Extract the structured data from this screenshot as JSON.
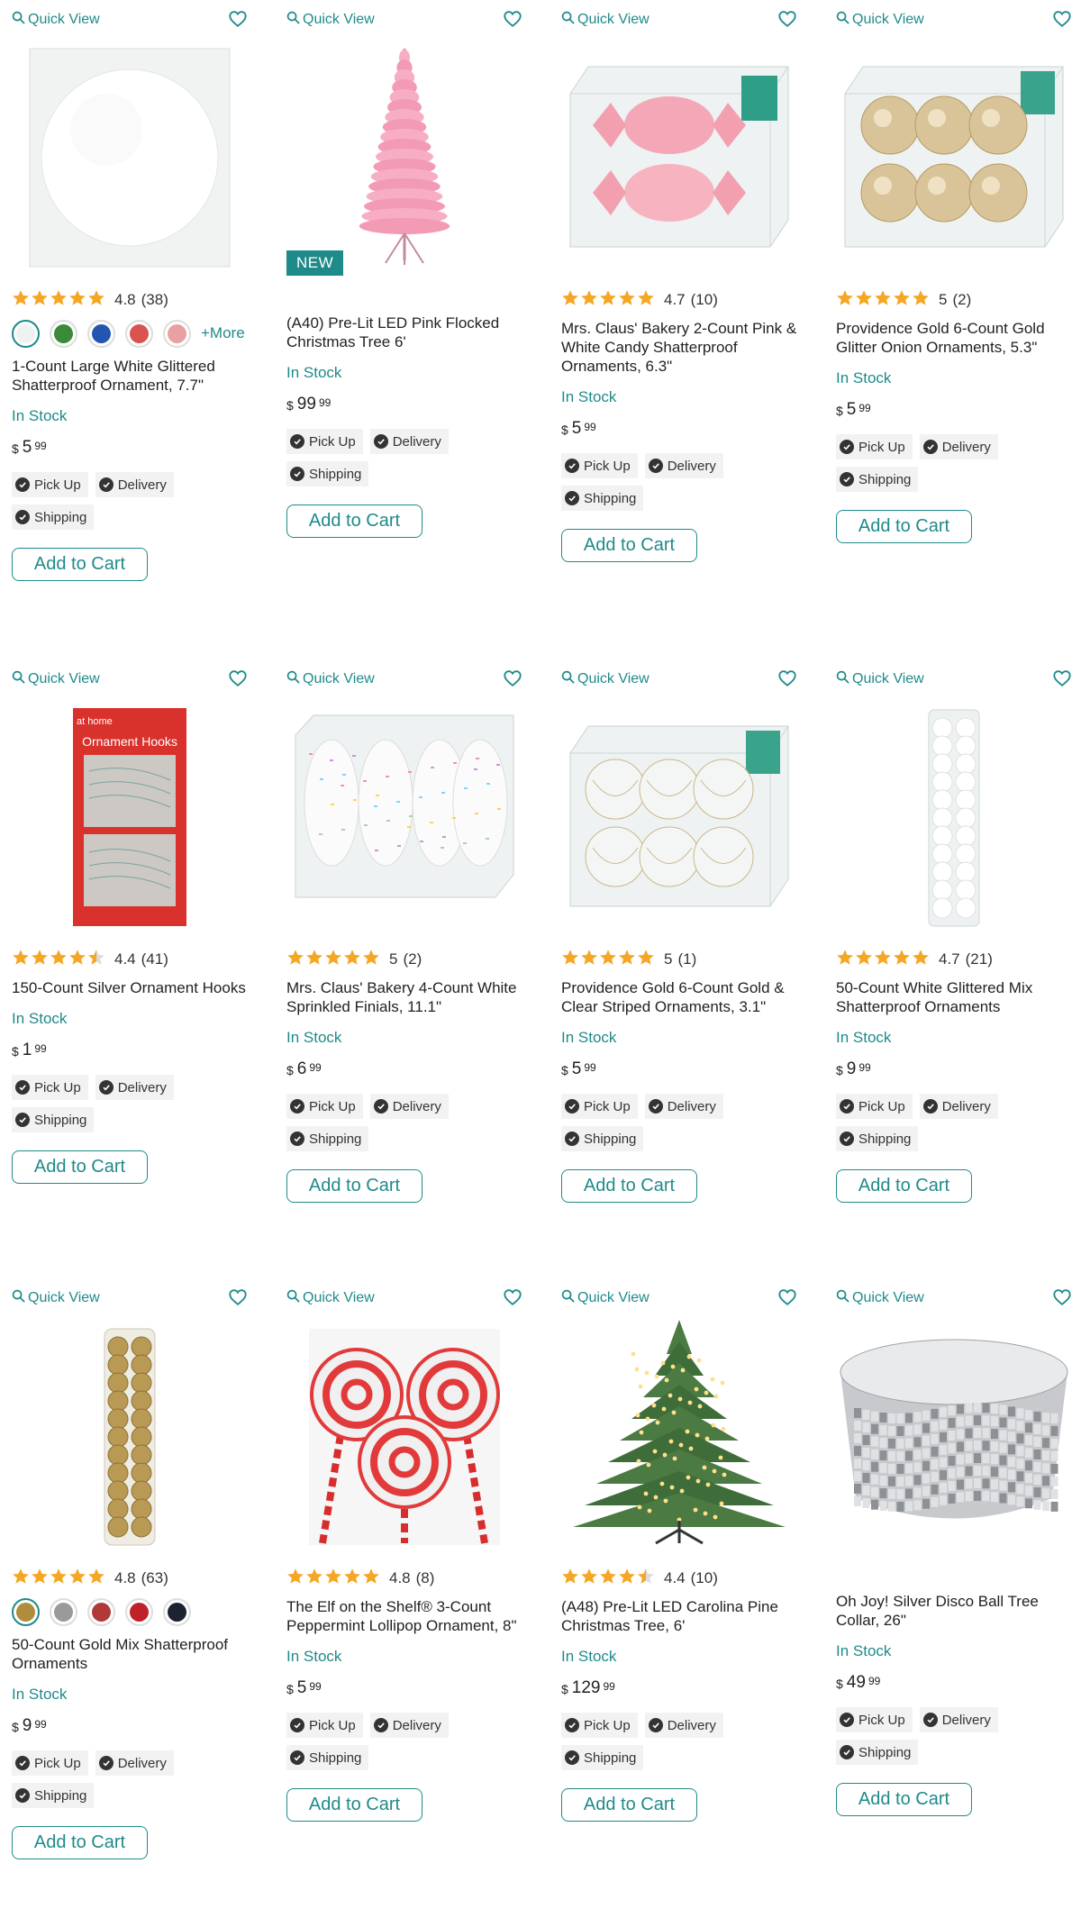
{
  "labels": {
    "quick_view": "Quick View",
    "add_to_cart": "Add to Cart",
    "pick_up": "Pick Up",
    "delivery": "Delivery",
    "shipping": "Shipping",
    "new_badge": "NEW",
    "more": "+More",
    "currency": "$"
  },
  "colors": {
    "accent": "#1f8a8a",
    "star": "#f5a623"
  },
  "products": [
    {
      "title": "1-Count Large White Glittered Shatterproof Ornament, 7.7\"",
      "rating": "4.8",
      "count": "(38)",
      "stars": 5,
      "stock": "In Stock",
      "dollars": "5",
      "cents": "99",
      "image": "white-ball",
      "badge": "",
      "swatches": [
        "#eef2f2",
        "#3a8a3a",
        "#2456b0",
        "#d9534f",
        "#e9a0a0"
      ]
    },
    {
      "title": "(A40) Pre-Lit LED Pink Flocked Christmas Tree 6'",
      "rating": "",
      "count": "",
      "stars": 0,
      "stock": "In Stock",
      "dollars": "99",
      "cents": "99",
      "image": "pink-tree",
      "badge": "NEW",
      "swatches": []
    },
    {
      "title": "Mrs. Claus' Bakery 2-Count Pink & White Candy Shatterproof Ornaments, 6.3\"",
      "rating": "4.7",
      "count": "(10)",
      "stars": 5,
      "stock": "In Stock",
      "dollars": "5",
      "cents": "99",
      "image": "pink-candy",
      "badge": "",
      "swatches": []
    },
    {
      "title": "Providence Gold 6-Count Gold Glitter Onion Ornaments, 5.3\"",
      "rating": "5",
      "count": "(2)",
      "stars": 5,
      "stock": "In Stock",
      "dollars": "5",
      "cents": "99",
      "image": "gold-onion",
      "badge": "",
      "swatches": []
    },
    {
      "title": "150-Count Silver Ornament Hooks",
      "rating": "4.4",
      "count": "(41)",
      "stars": 4.5,
      "stock": "In Stock",
      "dollars": "1",
      "cents": "99",
      "image": "hooks",
      "badge": "",
      "swatches": [],
      "pkg_brand": "at home",
      "pkg_title": "Ornament Hooks"
    },
    {
      "title": "Mrs. Claus' Bakery 4-Count White Sprinkled Finials, 11.1\"",
      "rating": "5",
      "count": "(2)",
      "stars": 5,
      "stock": "In Stock",
      "dollars": "6",
      "cents": "99",
      "image": "finials",
      "badge": "",
      "swatches": []
    },
    {
      "title": "Providence Gold 6-Count Gold & Clear Striped Ornaments, 3.1\"",
      "rating": "5",
      "count": "(1)",
      "stars": 5,
      "stock": "In Stock",
      "dollars": "5",
      "cents": "99",
      "image": "clear-striped",
      "badge": "",
      "swatches": []
    },
    {
      "title": "50-Count White Glittered Mix Shatterproof Ornaments",
      "rating": "4.7",
      "count": "(21)",
      "stars": 5,
      "stock": "In Stock",
      "dollars": "9",
      "cents": "99",
      "image": "white-tube",
      "badge": "",
      "swatches": []
    },
    {
      "title": "50-Count Gold Mix Shatterproof Ornaments",
      "rating": "4.8",
      "count": "(63)",
      "stars": 5,
      "stock": "In Stock",
      "dollars": "9",
      "cents": "99",
      "image": "gold-tube",
      "badge": "",
      "swatches": [
        "#b08d3c",
        "#9a9a9a",
        "#b03a3a",
        "#c0202a",
        "#1c2230"
      ]
    },
    {
      "title": "The Elf on the Shelf® 3-Count Peppermint Lollipop Ornament, 8\"",
      "rating": "4.8",
      "count": "(8)",
      "stars": 5,
      "stock": "In Stock",
      "dollars": "5",
      "cents": "99",
      "image": "lollipop",
      "badge": "",
      "swatches": []
    },
    {
      "title": "(A48) Pre-Lit LED Carolina Pine Christmas Tree, 6'",
      "rating": "4.4",
      "count": "(10)",
      "stars": 4.5,
      "stock": "In Stock",
      "dollars": "129",
      "cents": "99",
      "image": "green-tree",
      "badge": "",
      "swatches": []
    },
    {
      "title": "Oh Joy! Silver Disco Ball Tree Collar, 26\"",
      "rating": "",
      "count": "",
      "stars": 0,
      "stock": "In Stock",
      "dollars": "49",
      "cents": "99",
      "image": "disco-collar",
      "badge": "",
      "swatches": []
    }
  ]
}
